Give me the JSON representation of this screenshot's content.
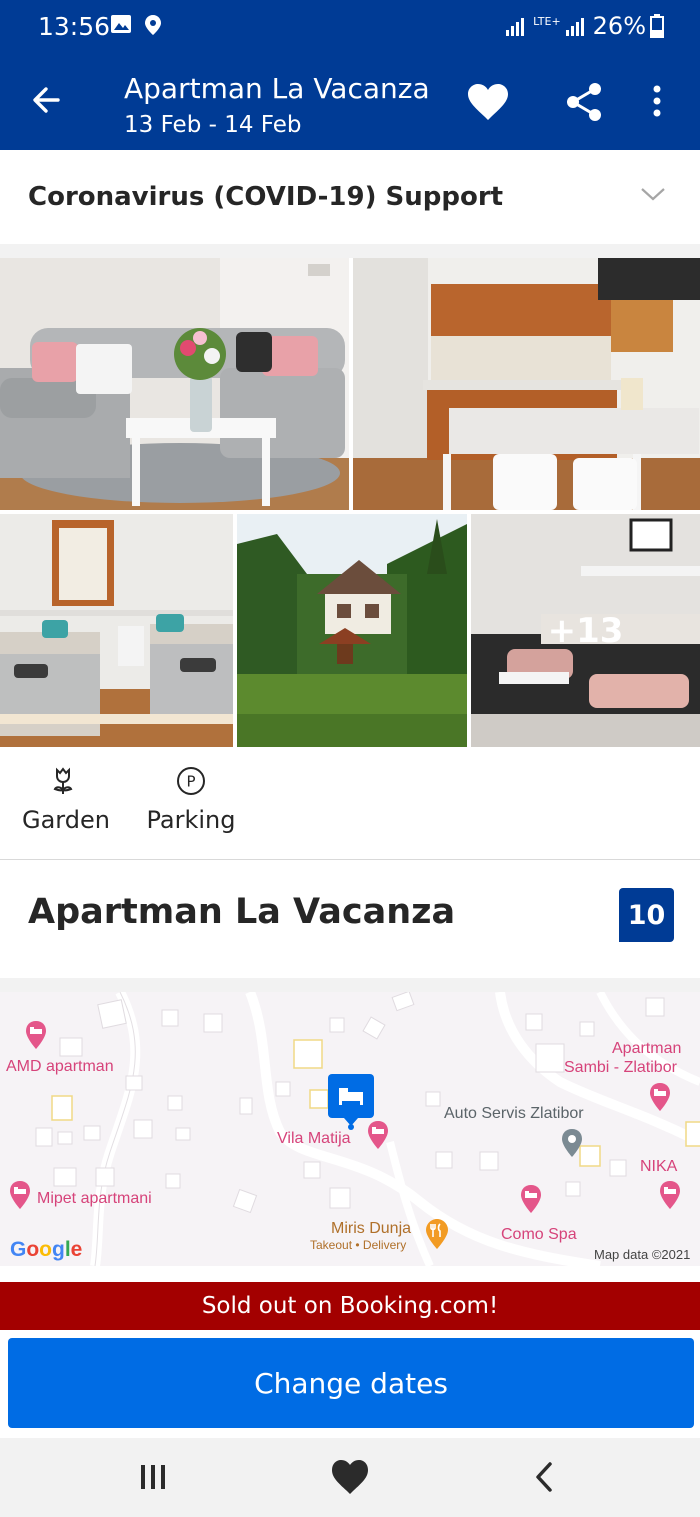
{
  "status_bar": {
    "time": "13:56",
    "network": "LTE+",
    "battery": "26%"
  },
  "header": {
    "title": "Apartman La Vacanza",
    "dates": "13 Feb - 14 Feb"
  },
  "covid": {
    "label": "Coronavirus (COVID-19) Support"
  },
  "photos": {
    "more_count": "+13"
  },
  "facilities": [
    {
      "label": "Garden",
      "icon": "flower-icon"
    },
    {
      "label": "Parking",
      "icon": "parking-icon"
    }
  ],
  "property": {
    "name": "Apartman La Vacanza",
    "score": "10"
  },
  "map": {
    "labels": {
      "amd": "AMD apartman",
      "sambi1": "Apartman",
      "sambi2": "Sambi - Zlatibor",
      "auto": "Auto Servis Zlatibor",
      "vila": "Vila Matija",
      "nika": "NIKA",
      "mipet": "Mipet apartmani",
      "miris": "Miris Dunja",
      "miris_sub": "Takeout • Delivery",
      "como": "Como Spa"
    },
    "google": "Google",
    "attribution": "Map data ©2021"
  },
  "banner": {
    "sold_out": "Sold out on Booking.com!"
  },
  "cta": {
    "label": "Change dates"
  },
  "colors": {
    "brand": "#003b95",
    "cta": "#006ce4",
    "sold_out": "#a30000"
  }
}
